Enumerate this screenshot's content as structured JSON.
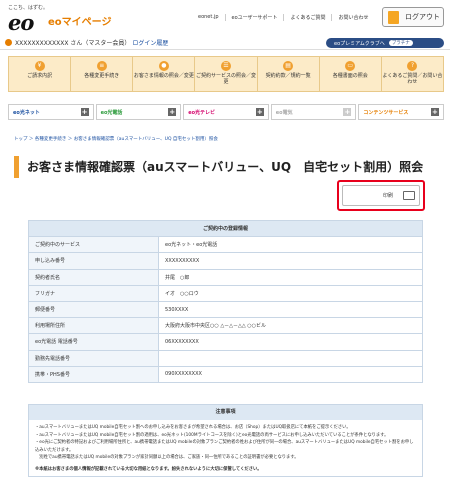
{
  "header": {
    "tagline": "ここち、はずむ。",
    "logo": "eo",
    "site_name": "eoマイページ",
    "links": [
      "eonet.jp",
      "eoユーザーサポート",
      "よくあるご質問",
      "お問い合わせ"
    ],
    "logout": "ログアウト"
  },
  "userbar": {
    "username": "XXXXXXXXXXXXX さん（マスター会員）",
    "login_history": "ログイン履歴",
    "premium": "eoプレミアムクラブへ",
    "rank": "プラチナ"
  },
  "menu": [
    "ご請求内訳",
    "各種変更手続き",
    "お客さま情報の照会／変更",
    "ご契約サービスの照会／変更",
    "契約約款／規約一覧",
    "各種書面の照会",
    "よくあるご質問／お問い合わせ"
  ],
  "services": [
    {
      "label": "eo光ネット",
      "color": "#1a4fa0"
    },
    {
      "label": "eo光電話",
      "color": "#2a9a3a"
    },
    {
      "label": "eo光テレビ",
      "color": "#d4006a"
    },
    {
      "label": "eo電気",
      "color": "#aaaaaa"
    },
    {
      "label": "コンテンツサービス",
      "color": "#e67e00"
    }
  ],
  "breadcrumb": "トップ ＞ 各種変更手続き ＞ お客さま情報確認票（auスマートバリュー、UQ 自宅セット割用）照会",
  "title": "お客さま情報確認票（auスマートバリュー、UQ　自宅セット割用）照会",
  "print_label": "印刷",
  "table": {
    "caption": "ご契約中の登録情報",
    "rows": [
      {
        "k": "ご契約中のサービス",
        "v": "eo光ネット・eo光電話"
      },
      {
        "k": "申し込み番号",
        "v": "XXXXXXXXXX"
      },
      {
        "k": "契約者氏名",
        "v": "井尾　○郎"
      },
      {
        "k": "フリガナ",
        "v": "イオ　○○ロウ"
      },
      {
        "k": "郵便番号",
        "v": "530XXXX"
      },
      {
        "k": "利用場所住所",
        "v": "大阪府大阪市中央区○○ △－△－△△ ○○ビル"
      },
      {
        "k": "eo光電話 電話番号",
        "v": "06XXXXXXXX"
      },
      {
        "k": "勤務先電話番号",
        "v": ""
      },
      {
        "k": "携帯・PHS番号",
        "v": "090XXXXXXXX"
      }
    ]
  },
  "notes": {
    "caption": "注意事項",
    "items": [
      "・auスマートバリューまたはUQ mobile自宅セット割へのお申し込みをお客さまが希望される場合は、お店（Shop）またはUQ取扱店にて本紙をご提示ください。",
      "・auスマートバリューまたはUQ mobile自宅セット割の適用は、eo光ネット(100Mライトコースを除く)とeo光電話の両サービスにお申し込みいただいていることが条件となります。",
      "・eo光にご契約者の特記およびご利用場所住所と、au携帯電話またはUQ mobileの対象プランご契約者の姓および住所が同一の場合、auスマートバリューまたはUQ mobile自宅セット割をお申し込みいただけます。",
      "　別姓でau携帯電話またはUQ mobileの対象プランが家計同額以上の場合は、ご家族・同一住所であることの証明書が必要となります。"
    ],
    "warning": "※本紙はお客さまの個人情報が記載されている大切な用紙となります。紛失されないように大切に保管してください。"
  }
}
